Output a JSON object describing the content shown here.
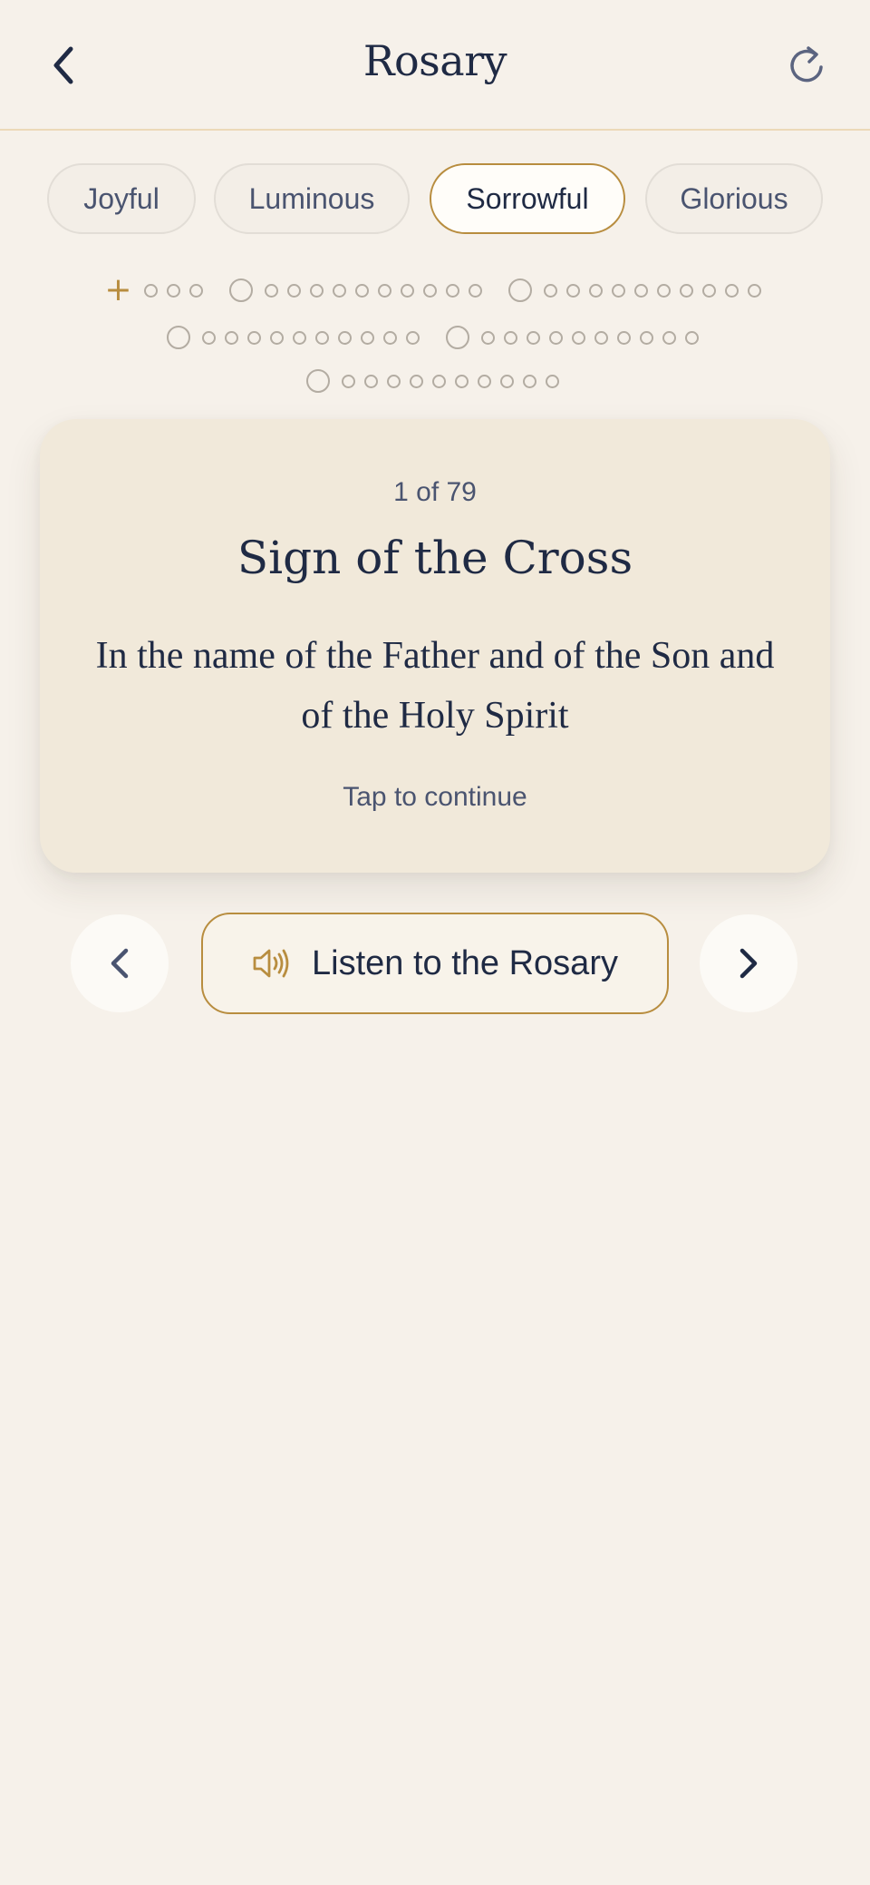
{
  "header": {
    "title": "Rosary",
    "back_icon": "chevron-left-icon",
    "reset_icon": "refresh-icon"
  },
  "tabs": [
    {
      "label": "Joyful",
      "active": false
    },
    {
      "label": "Luminous",
      "active": false
    },
    {
      "label": "Sorrowful",
      "active": true
    },
    {
      "label": "Glorious",
      "active": false
    }
  ],
  "beads": {
    "cross_glyph": "+",
    "current_index": 1,
    "total": 79
  },
  "card": {
    "counter": "1 of 79",
    "title": "Sign of the Cross",
    "text": "In the name of the Father and of the Son and of the Holy Spirit",
    "hint": "Tap to continue"
  },
  "controls": {
    "listen_label": "Listen to the Rosary",
    "listen_icon": "speaker-icon",
    "prev_icon": "chevron-left-icon",
    "next_icon": "chevron-right-icon"
  },
  "colors": {
    "background": "#f6f1ea",
    "accent_gold": "#b88d3f",
    "navy": "#1f2a44",
    "card": "#f1e9da"
  }
}
